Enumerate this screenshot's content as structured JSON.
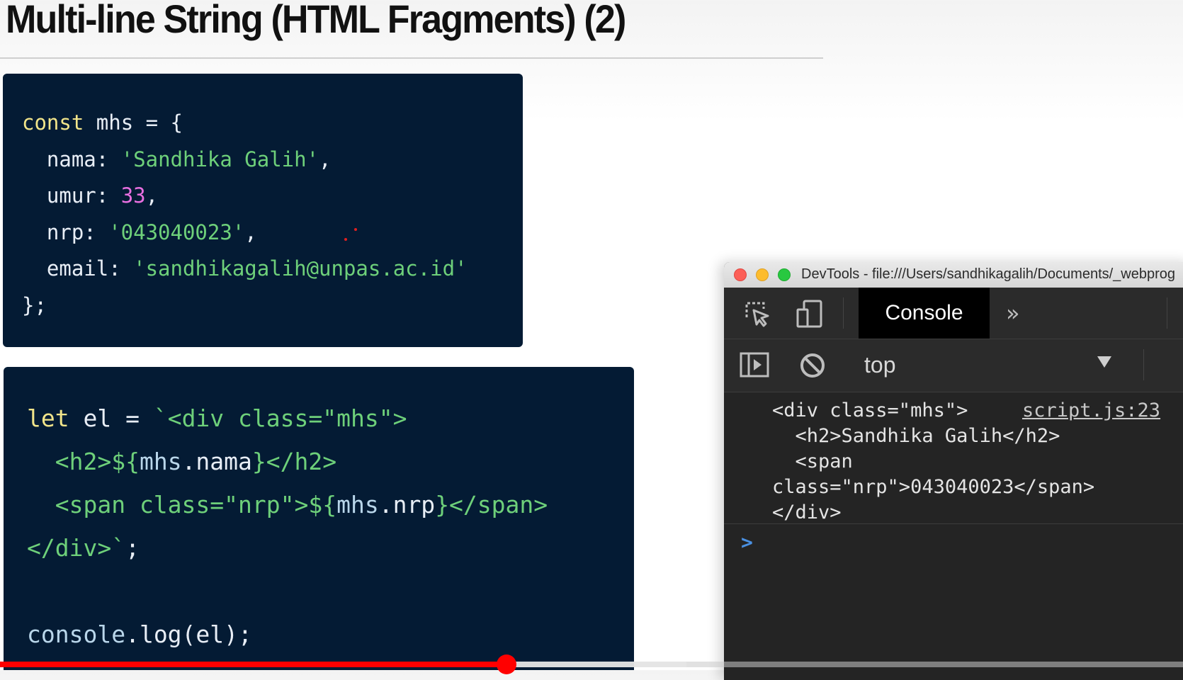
{
  "slide": {
    "title": "Multi-line String (HTML Fragments) (2)"
  },
  "code_block_1": {
    "lines": [
      [
        {
          "t": "const",
          "c": "kw"
        },
        {
          "t": " mhs = {",
          "c": "pn"
        }
      ],
      [
        {
          "t": "  nama: ",
          "c": "pn"
        },
        {
          "t": "'Sandhika Galih'",
          "c": "str"
        },
        {
          "t": ",",
          "c": "pn"
        }
      ],
      [
        {
          "t": "  umur: ",
          "c": "pn"
        },
        {
          "t": "33",
          "c": "num"
        },
        {
          "t": ",",
          "c": "pn"
        }
      ],
      [
        {
          "t": "  nrp: ",
          "c": "pn"
        },
        {
          "t": "'043040023'",
          "c": "str"
        },
        {
          "t": ",",
          "c": "pn"
        }
      ],
      [
        {
          "t": "  email: ",
          "c": "pn"
        },
        {
          "t": "'sandhikagalih@unpas.ac.id'",
          "c": "str"
        }
      ],
      [
        {
          "t": "};",
          "c": "pn"
        }
      ]
    ]
  },
  "code_block_2": {
    "lines": [
      [
        {
          "t": "let",
          "c": "kw"
        },
        {
          "t": " el = ",
          "c": "pn"
        },
        {
          "t": "`<div class=\"mhs\">",
          "c": "str"
        }
      ],
      [
        {
          "t": "  <h2>${",
          "c": "str"
        },
        {
          "t": "mhs",
          "c": "fn"
        },
        {
          "t": ".nama",
          "c": "pn"
        },
        {
          "t": "}</h2>",
          "c": "str"
        }
      ],
      [
        {
          "t": "  <span class=\"nrp\">${",
          "c": "str"
        },
        {
          "t": "mhs",
          "c": "fn"
        },
        {
          "t": ".nrp",
          "c": "pn"
        },
        {
          "t": "}</span>",
          "c": "str"
        }
      ],
      [
        {
          "t": "</div>`",
          "c": "str"
        },
        {
          "t": ";",
          "c": "pn"
        }
      ],
      [
        {
          "t": " ",
          "c": "pn"
        }
      ],
      [
        {
          "t": "console",
          "c": "fn"
        },
        {
          "t": ".log(el);",
          "c": "pn"
        }
      ]
    ]
  },
  "devtools": {
    "window_title": "DevTools - file:///Users/sandhikagalih/Documents/_webprog",
    "toolbar": {
      "inspect_icon": "element-picker-icon",
      "device_icon": "device-toolbar-icon",
      "console_tab_label": "Console",
      "more_tabs_icon": "double-chevron-right-icon",
      "more_tabs_glyph": "»"
    },
    "filterbar": {
      "sidebar_icon": "show-sidebar-icon",
      "clear_icon": "clear-console-icon",
      "context_value": "top",
      "context_dropdown_icon": "triangle-down-icon"
    },
    "console": {
      "log_text": "<div class=\"mhs\">\n  <h2>Sandhika Galih</h2>\n  <span\nclass=\"nrp\">043040023</span>\n</div>",
      "log_source": "script.js:23",
      "prompt_glyph": ">"
    },
    "colors": {
      "traffic_red": "#fc5f57",
      "traffic_yellow": "#fdbc2e",
      "traffic_green": "#28c840"
    }
  },
  "video": {
    "progress_fraction": 0.428,
    "buffered_fraction": 0.58,
    "progress_color": "#ff0000"
  }
}
